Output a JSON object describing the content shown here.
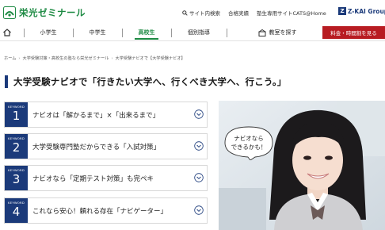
{
  "header": {
    "logo_text": "栄光ゼミナール",
    "links": [
      {
        "label": "サイト内検索",
        "icon": "search-icon"
      },
      {
        "label": "合格実績"
      },
      {
        "label": "塾生専用サイトCATS@Home"
      }
    ],
    "group_logo_text": "Z-KAI Group"
  },
  "nav": {
    "home_icon": "home-icon",
    "items": [
      {
        "label": "小学生"
      },
      {
        "label": "中学生"
      },
      {
        "label": "高校生",
        "active": true
      },
      {
        "label": "個別指導"
      },
      {
        "label": "教室を探す",
        "icon": "school-icon"
      }
    ],
    "cta_label": "料金・時間割を見る",
    "accent_color": "#1d8a43",
    "cta_color": "#b81c22"
  },
  "breadcrumb": [
    "ホーム",
    "大学受験対策・高校生の塾なら栄光ゼミナール",
    "大学受験ナビオで【大学受験ナビオ】"
  ],
  "headline": "大学受験ナビオで「行きたい大学へ、行くべき大学へ、行こう。」",
  "keywords": [
    {
      "label": "KEYWORD",
      "number": "1",
      "text": "ナビオは「解かるまで」×「出来るまで」"
    },
    {
      "label": "KEYWORD",
      "number": "2",
      "text": "大学受験専門塾だからできる「入試対策」"
    },
    {
      "label": "KEYWORD",
      "number": "3",
      "text": "ナビオなら「定期テスト対策」も完ペキ"
    },
    {
      "label": "KEYWORD",
      "number": "4",
      "text": "これなら安心！頼れる存在「ナビゲーター」"
    }
  ],
  "hero": {
    "bubble_line1": "ナビオなら",
    "bubble_line2": "できるかも！"
  },
  "colors": {
    "navy": "#1b3a7a",
    "green": "#1d8a43",
    "red": "#b81c22"
  }
}
